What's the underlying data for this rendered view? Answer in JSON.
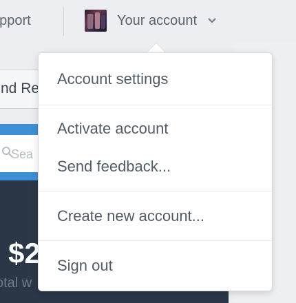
{
  "header": {
    "support_label": "upport",
    "account_label": "Your account"
  },
  "background": {
    "button_label": "nd Re",
    "search_placeholder": "Sea",
    "amount": "$2",
    "sub_label": "otal w"
  },
  "menu": {
    "items": [
      {
        "label": "Account settings"
      },
      {
        "label": "Activate account"
      },
      {
        "label": "Send feedback..."
      },
      {
        "label": "Create new account..."
      },
      {
        "label": "Sign out"
      }
    ]
  },
  "colors": {
    "accent_blue": "#3e8fd3",
    "dark_panel": "#2b3746"
  }
}
